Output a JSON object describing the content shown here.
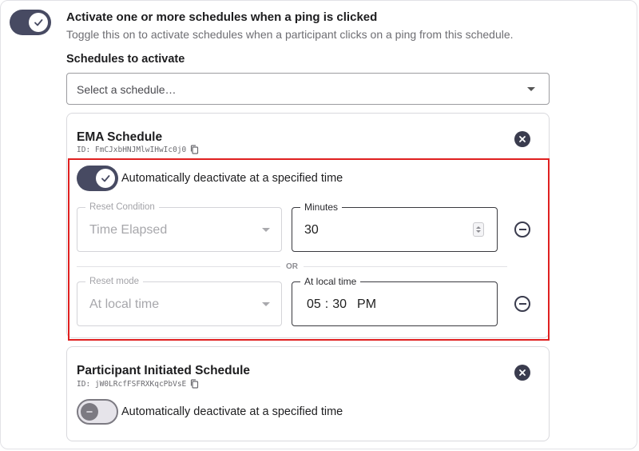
{
  "activate_section": {
    "toggle_on": true,
    "title": "Activate one or more schedules when a ping is clicked",
    "description": "Toggle this on to activate schedules when a participant clicks on a ping from this schedule."
  },
  "schedules_to_activate": {
    "label": "Schedules to activate",
    "select_placeholder": "Select a schedule…"
  },
  "cards": [
    {
      "title": "EMA Schedule",
      "id_text": "ID: FmCJxbHNJMlwIHwIc0j0",
      "deactivate_toggle_on": true,
      "deactivate_label": "Automatically deactivate at a specified time",
      "conditions": [
        {
          "reset_label": "Reset Condition",
          "reset_value": "Time Elapsed",
          "field_label": "Minutes",
          "field_value": "30"
        },
        {
          "reset_label": "Reset mode",
          "reset_value": "At local time",
          "field_label": "At local time",
          "time_hours": "05",
          "time_sep": ":",
          "time_minutes": "30",
          "time_ampm": "PM"
        }
      ],
      "or_text": "OR"
    },
    {
      "title": "Participant Initiated Schedule",
      "id_text": "ID: jW0LRcfFSFRXKqcPbVsE",
      "deactivate_toggle_on": false,
      "deactivate_label": "Automatically deactivate at a specified time"
    }
  ],
  "colors": {
    "toggle_on": "#474a62",
    "highlight_border": "#e02020",
    "icon_dark": "#3a3c4e"
  },
  "icons": {
    "check": "check-icon",
    "close": "close-circle-icon",
    "remove": "minus-circle-icon",
    "copy": "copy-icon",
    "dropdown": "chevron-down-icon"
  }
}
